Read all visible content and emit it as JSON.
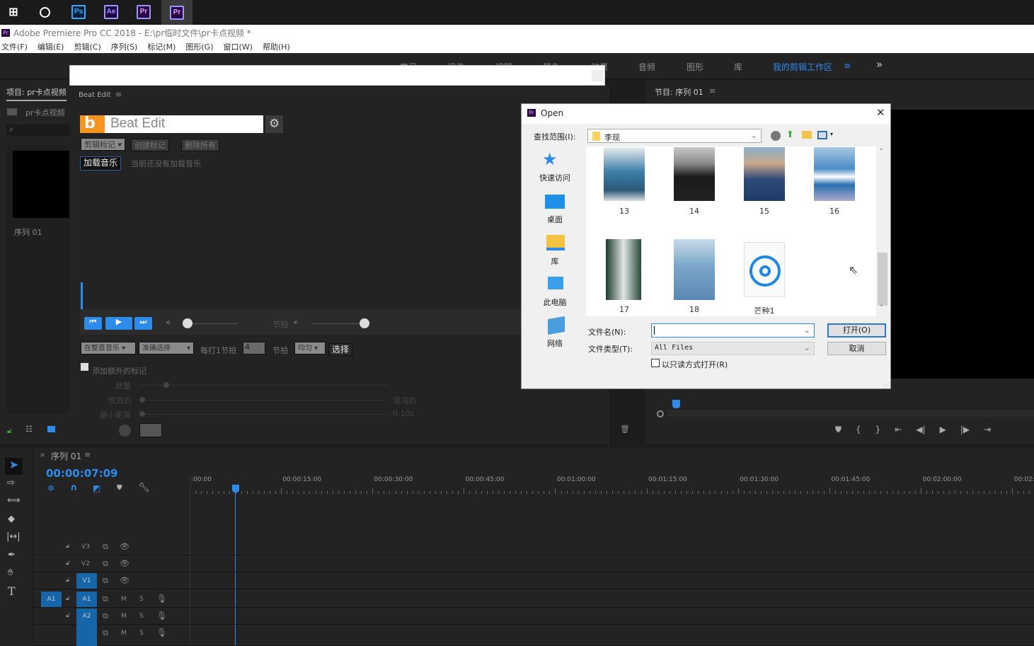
{
  "taskbar": {
    "apps": [
      "Ps",
      "Ae",
      "Pr",
      "Pr"
    ]
  },
  "window": {
    "title": "Adobe Premiere Pro CC 2018 - E:\\pr临时文件\\pr卡点视频 *"
  },
  "menu": [
    "文件(F)",
    "编辑(E)",
    "剪辑(C)",
    "序列(S)",
    "标记(M)",
    "图形(G)",
    "窗口(W)",
    "帮助(H)"
  ],
  "workspaces": {
    "tabs": [
      "学习",
      "组件",
      "编辑",
      "颜色",
      "效果",
      "音频",
      "图形",
      "库"
    ],
    "active": "我的剪辑工作区",
    "more": "»"
  },
  "project": {
    "tab": "项目: pr卡点视频",
    "name": "pr卡点视频",
    "item": "序列 01"
  },
  "beatedit": {
    "tab": "Beat Edit",
    "logo": "Beat Edit",
    "marker_mode": "剪辑标记",
    "create": "创建标记",
    "delete_all": "删除所有",
    "load": "加载音乐",
    "status": "当前还没有加载音乐",
    "beat_label": "节拍",
    "scope": "在整首音乐",
    "precision": "准确选择",
    "every": "每打1节拍",
    "beats": "4",
    "beat_unit": "节拍",
    "distribution": "均匀",
    "select": "选择",
    "extra": "添加额外的标记",
    "count": "数量",
    "pleasant": "悦耳的",
    "chaotic": "混沌的",
    "min_dist": "最小距离",
    "min_val": "0.10s",
    "volume_level": 0.05,
    "beat_volume_level": 1.0
  },
  "program": {
    "tab": "节目: 序列 01"
  },
  "dialog": {
    "title": "Open",
    "lookin_label": "查找范围(I):",
    "folder": "李现",
    "places": [
      "快速访问",
      "桌面",
      "库",
      "此电脑",
      "网络"
    ],
    "files": [
      "13",
      "14",
      "15",
      "16",
      "17",
      "18",
      "芒种1"
    ],
    "filename_label": "文件名(N):",
    "filename": "",
    "filetype_label": "文件类型(T):",
    "filetype": "All Files",
    "readonly": "以只读方式打开(R)",
    "open": "打开(O)",
    "cancel": "取消"
  },
  "timeline": {
    "tab": "序列 01",
    "timecode": "00:00:07:09",
    "ruler": [
      ":00:00",
      "00:00:15:00",
      "00:00:30:00",
      "00:00:45:00",
      "00:01:00:00",
      "00:01:15:00",
      "00:01:30:00",
      "00:01:45:00",
      "00:02:00:00",
      "00:02:15:00"
    ],
    "video_tracks": [
      "V3",
      "V2",
      "V1"
    ],
    "audio_tracks": [
      "A1",
      "A2",
      ""
    ],
    "source": "A1",
    "m": "M",
    "s": "S"
  },
  "colors": {
    "accent": "#2d8ceb",
    "beatedit_orange": "#f7941d"
  }
}
